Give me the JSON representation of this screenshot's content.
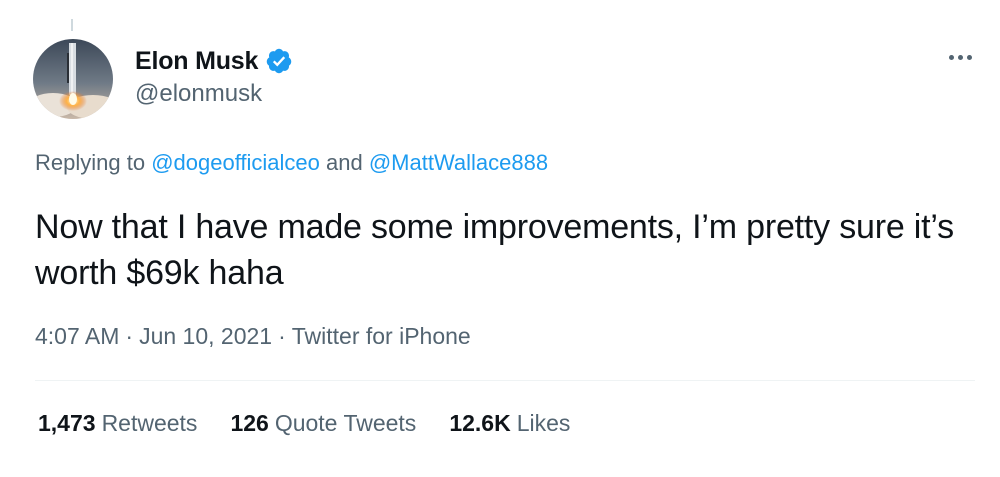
{
  "author": {
    "display_name": "Elon Musk",
    "handle": "@elonmusk",
    "verified_icon": "verified-badge-icon",
    "avatar": "rocket-launch-avatar"
  },
  "reply": {
    "prefix": "Replying to ",
    "user1": "@dogeofficialceo",
    "conjunction": " and ",
    "user2": "@MattWallace888"
  },
  "tweet": {
    "text": "Now that I have made some improvements, I’m pretty sure it’s worth $69k haha"
  },
  "meta": {
    "time": "4:07 AM",
    "separator": "·",
    "date": "Jun 10, 2021",
    "source": "Twitter for iPhone"
  },
  "stats": {
    "retweets_count": "1,473",
    "retweets_label": "Retweets",
    "quotes_count": "126",
    "quotes_label": "Quote Tweets",
    "likes_count": "12.6K",
    "likes_label": "Likes"
  },
  "colors": {
    "link": "#1d9bf0",
    "secondary_text": "#536471",
    "primary_text": "#0f1419",
    "verified": "#1d9bf0"
  }
}
